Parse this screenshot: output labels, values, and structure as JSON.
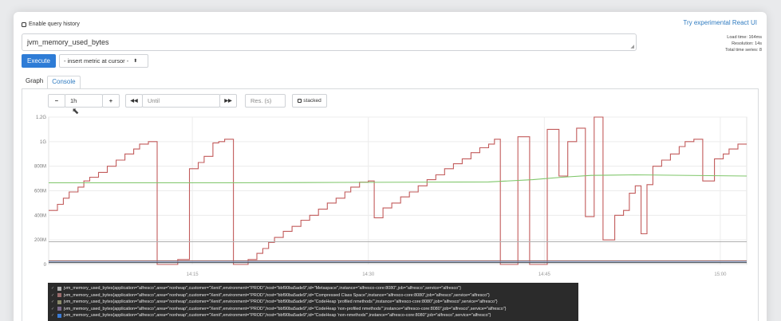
{
  "header": {
    "history_label": "Enable query history",
    "react_link": "Try experimental React UI"
  },
  "query": {
    "expression": "jvm_memory_used_bytes"
  },
  "stats": {
    "load_time": "Load time: 164ms",
    "resolution": "Resolution: 14s",
    "total_series": "Total time series: 8"
  },
  "toolbar": {
    "execute_label": "Execute",
    "insert_metric_label": "- insert metric at cursor -",
    "insert_arrow": "⬍"
  },
  "tabs": [
    {
      "label": "Graph"
    },
    {
      "label": "Console"
    }
  ],
  "graph_controls": {
    "minus": "−",
    "range": "1h",
    "plus": "+",
    "back": "◀◀",
    "until_placeholder": "Until",
    "forward": "▶▶",
    "res_placeholder": "Res. (s)",
    "stacked_label": "stacked"
  },
  "chart_data": {
    "type": "line",
    "y_ticks": [
      "0",
      "200M",
      "400M",
      "600M",
      "800M",
      "1G",
      "1.2G"
    ],
    "x_ticks": [
      "14:15",
      "14:30",
      "14:45",
      "15:00"
    ],
    "ylim": [
      0,
      1200000000
    ],
    "grid": true,
    "series": [
      {
        "color": "#c25b5b",
        "values": [
          [
            0,
            440
          ],
          [
            3,
            440
          ],
          [
            3,
            490
          ],
          [
            5,
            490
          ],
          [
            5,
            540
          ],
          [
            7,
            540
          ],
          [
            7,
            590
          ],
          [
            10,
            590
          ],
          [
            10,
            630
          ],
          [
            12,
            630
          ],
          [
            12,
            680
          ],
          [
            14,
            680
          ],
          [
            14,
            710
          ],
          [
            17,
            710
          ],
          [
            17,
            750
          ],
          [
            20,
            750
          ],
          [
            20,
            800
          ],
          [
            23,
            800
          ],
          [
            23,
            850
          ],
          [
            26,
            850
          ],
          [
            26,
            900
          ],
          [
            29,
            900
          ],
          [
            29,
            940
          ],
          [
            31,
            940
          ],
          [
            31,
            980
          ],
          [
            34,
            980
          ],
          [
            34,
            1000
          ],
          [
            37,
            1000
          ],
          [
            37,
            0
          ],
          [
            44,
            0
          ],
          [
            44,
            40
          ],
          [
            48,
            40
          ],
          [
            48,
            780
          ],
          [
            51,
            780
          ],
          [
            51,
            830
          ],
          [
            53,
            830
          ],
          [
            53,
            880
          ],
          [
            56,
            880
          ],
          [
            56,
            990
          ],
          [
            58,
            990
          ],
          [
            58,
            1000
          ],
          [
            60,
            1000
          ],
          [
            60,
            1020
          ],
          [
            63,
            1020
          ],
          [
            63,
            0
          ],
          [
            68,
            0
          ],
          [
            68,
            40
          ],
          [
            71,
            40
          ],
          [
            71,
            90
          ],
          [
            73,
            90
          ],
          [
            73,
            130
          ],
          [
            75,
            130
          ],
          [
            75,
            180
          ],
          [
            77,
            180
          ],
          [
            77,
            220
          ],
          [
            80,
            220
          ],
          [
            80,
            270
          ],
          [
            83,
            270
          ],
          [
            83,
            310
          ],
          [
            86,
            310
          ],
          [
            86,
            360
          ],
          [
            89,
            360
          ],
          [
            89,
            400
          ],
          [
            92,
            400
          ],
          [
            92,
            450
          ],
          [
            95,
            450
          ],
          [
            95,
            500
          ],
          [
            98,
            500
          ],
          [
            98,
            540
          ],
          [
            101,
            540
          ],
          [
            101,
            590
          ],
          [
            103,
            590
          ],
          [
            103,
            630
          ],
          [
            106,
            630
          ],
          [
            106,
            670
          ],
          [
            109,
            670
          ],
          [
            109,
            680
          ],
          [
            111,
            680
          ],
          [
            111,
            380
          ],
          [
            114,
            380
          ],
          [
            114,
            460
          ],
          [
            117,
            460
          ],
          [
            117,
            500
          ],
          [
            120,
            500
          ],
          [
            120,
            550
          ],
          [
            123,
            550
          ],
          [
            123,
            590
          ],
          [
            126,
            590
          ],
          [
            126,
            640
          ],
          [
            129,
            640
          ],
          [
            129,
            690
          ],
          [
            132,
            690
          ],
          [
            132,
            730
          ],
          [
            135,
            730
          ],
          [
            135,
            780
          ],
          [
            138,
            780
          ],
          [
            138,
            820
          ],
          [
            141,
            820
          ],
          [
            141,
            860
          ],
          [
            144,
            860
          ],
          [
            144,
            910
          ],
          [
            147,
            910
          ],
          [
            147,
            950
          ],
          [
            150,
            950
          ],
          [
            150,
            980
          ],
          [
            152,
            980
          ],
          [
            152,
            1020
          ],
          [
            154,
            1020
          ],
          [
            154,
            0
          ],
          [
            160,
            0
          ],
          [
            160,
            1040
          ],
          [
            164,
            1040
          ],
          [
            164,
            0
          ],
          [
            170,
            0
          ],
          [
            170,
            1100
          ],
          [
            174,
            1100
          ],
          [
            174,
            720
          ],
          [
            177,
            720
          ],
          [
            177,
            1000
          ],
          [
            180,
            1000
          ],
          [
            180,
            1110
          ],
          [
            183,
            1110
          ],
          [
            183,
            390
          ],
          [
            186,
            390
          ],
          [
            186,
            1200
          ],
          [
            189,
            1200
          ],
          [
            189,
            200
          ],
          [
            193,
            200
          ],
          [
            193,
            400
          ],
          [
            196,
            400
          ],
          [
            196,
            440
          ],
          [
            198,
            440
          ],
          [
            198,
            580
          ],
          [
            200,
            580
          ],
          [
            200,
            640
          ],
          [
            202,
            640
          ],
          [
            202,
            250
          ],
          [
            204,
            250
          ],
          [
            204,
            650
          ],
          [
            206,
            650
          ],
          [
            206,
            800
          ],
          [
            209,
            800
          ],
          [
            209,
            850
          ],
          [
            212,
            850
          ],
          [
            212,
            900
          ],
          [
            215,
            900
          ],
          [
            215,
            960
          ],
          [
            217,
            960
          ],
          [
            217,
            1000
          ],
          [
            220,
            1000
          ],
          [
            220,
            1020
          ],
          [
            223,
            1020
          ],
          [
            223,
            680
          ],
          [
            227,
            680
          ],
          [
            227,
            860
          ],
          [
            230,
            860
          ],
          [
            230,
            900
          ],
          [
            232,
            900
          ],
          [
            232,
            940
          ],
          [
            235,
            940
          ],
          [
            235,
            980
          ],
          [
            238,
            980
          ],
          [
            238,
            980
          ]
        ]
      },
      {
        "color": "#7fc66a",
        "values": [
          [
            0,
            665
          ],
          [
            60,
            665
          ],
          [
            100,
            668
          ],
          [
            150,
            672
          ],
          [
            165,
            690
          ],
          [
            175,
            710
          ],
          [
            185,
            725
          ],
          [
            200,
            730
          ],
          [
            238,
            720
          ]
        ]
      },
      {
        "color": "#b0b0b0",
        "values": [
          [
            0,
            185
          ],
          [
            238,
            185
          ]
        ]
      },
      {
        "color": "#9a6b6b",
        "values": [
          [
            0,
            30
          ],
          [
            238,
            30
          ]
        ]
      },
      {
        "color": "#6f9fd8",
        "values": [
          [
            0,
            20
          ],
          [
            238,
            20
          ]
        ]
      },
      {
        "color": "#555555",
        "values": [
          [
            0,
            15
          ],
          [
            238,
            15
          ]
        ]
      }
    ]
  },
  "legend": [
    {
      "color": "#b0b0b0",
      "text": "jvm_memory_used_bytes{application=\"alfresco\",area=\"nonheap\",customer=\"Xenit\",environment=\"PROD\",host=\"bbf90ba5ade9\",id=\"Metaspace\",instance=\"alfresco-core:8080\",job=\"alfresco\",service=\"alfresco\"}"
    },
    {
      "color": "#9a6b6b",
      "text": "jvm_memory_used_bytes{application=\"alfresco\",area=\"nonheap\",customer=\"Xenit\",environment=\"PROD\",host=\"bbf90ba5ade9\",id=\"Compressed Class Space\",instance=\"alfresco-core:8080\",job=\"alfresco\",service=\"alfresco\"}"
    },
    {
      "color": "#8a8a6a",
      "text": "jvm_memory_used_bytes{application=\"alfresco\",area=\"nonheap\",customer=\"Xenit\",environment=\"PROD\",host=\"bbf90ba5ade9\",id=\"CodeHeap 'profiled nmethods'\",instance=\"alfresco-core:8080\",job=\"alfresco\",service=\"alfresco\"}"
    },
    {
      "color": "#7a6a8a",
      "text": "jvm_memory_used_bytes{application=\"alfresco\",area=\"nonheap\",customer=\"Xenit\",environment=\"PROD\",host=\"bbf90ba5ade9\",id=\"CodeHeap 'non-profiled nmethods'\",instance=\"alfresco-core:8080\",job=\"alfresco\",service=\"alfresco\"}"
    },
    {
      "color": "#3a7bd5",
      "text": "jvm_memory_used_bytes{application=\"alfresco\",area=\"nonheap\",customer=\"Xenit\",environment=\"PROD\",host=\"bbf90ba5ade9\",id=\"CodeHeap 'non-nmethods'\",instance=\"alfresco-core:8080\",job=\"alfresco\",service=\"alfresco\"}"
    }
  ]
}
